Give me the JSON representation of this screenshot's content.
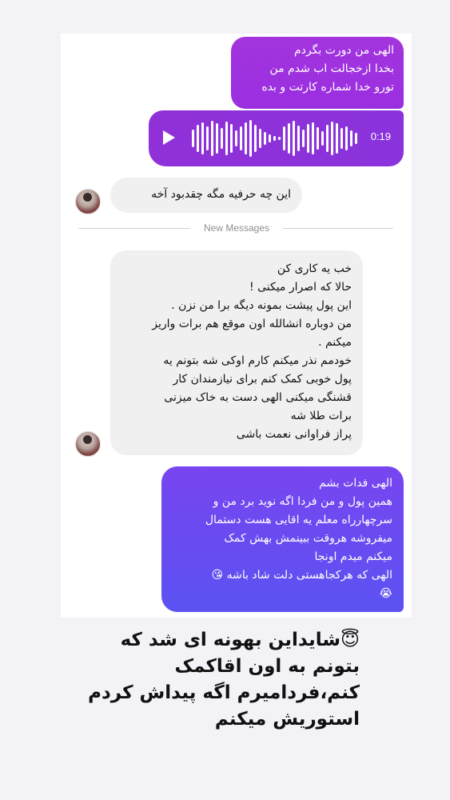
{
  "messages": [
    {
      "id": "out1",
      "text": "الهی من دورت بگردم\nبخدا ازخجالت اب شدم من\nتورو خدا شماره کارتت و بده"
    },
    {
      "id": "voice",
      "duration": "0:19"
    },
    {
      "id": "in1",
      "text": "این چه حرفیه مگه چقدبود آخه"
    },
    {
      "id": "in2",
      "text": "خب یه کاری کن\nحالا که اصرار میکنی !\nاین پول پیشت بمونه دیگه برا من نزن .\nمن دوباره انشالله اون موقع هم برات واریز\nمیکنم .\nخودمم نذر میکنم کارم اوکی شه بتونم یه\nپول خوبی کمک کنم برای نیازمندان کار\nقشنگی میکنی الهی دست به خاک میزنی\nبرات طلا شه\nپراز فراوانی نعمت باشی"
    },
    {
      "id": "out2",
      "text": "الهی فدات بشم\nهمین پول و من فردا اگه نوید برد من و\nسرچهارراه معلم یه اقایی هست دستمال\nمیفروشه هروقت ببینمش بهش کمک\nمیکنم میدم اونجا\nالهی که هرکجاهستی دلت شاد باشه 😘\n😭"
    }
  ],
  "divider": {
    "label": "New Messages"
  },
  "caption": {
    "text": "😇شایداین بهونه ای شد که\nبتونم به اون اقاکمک\nکنم،فردامیرم اگه پیداش کردم\nاستوریش میکنم"
  },
  "colors": {
    "outgoing_top": "#a334de",
    "outgoing_bottom": "#5b52f2",
    "incoming": "#f0f0f0",
    "background": "#f3f2f7"
  }
}
